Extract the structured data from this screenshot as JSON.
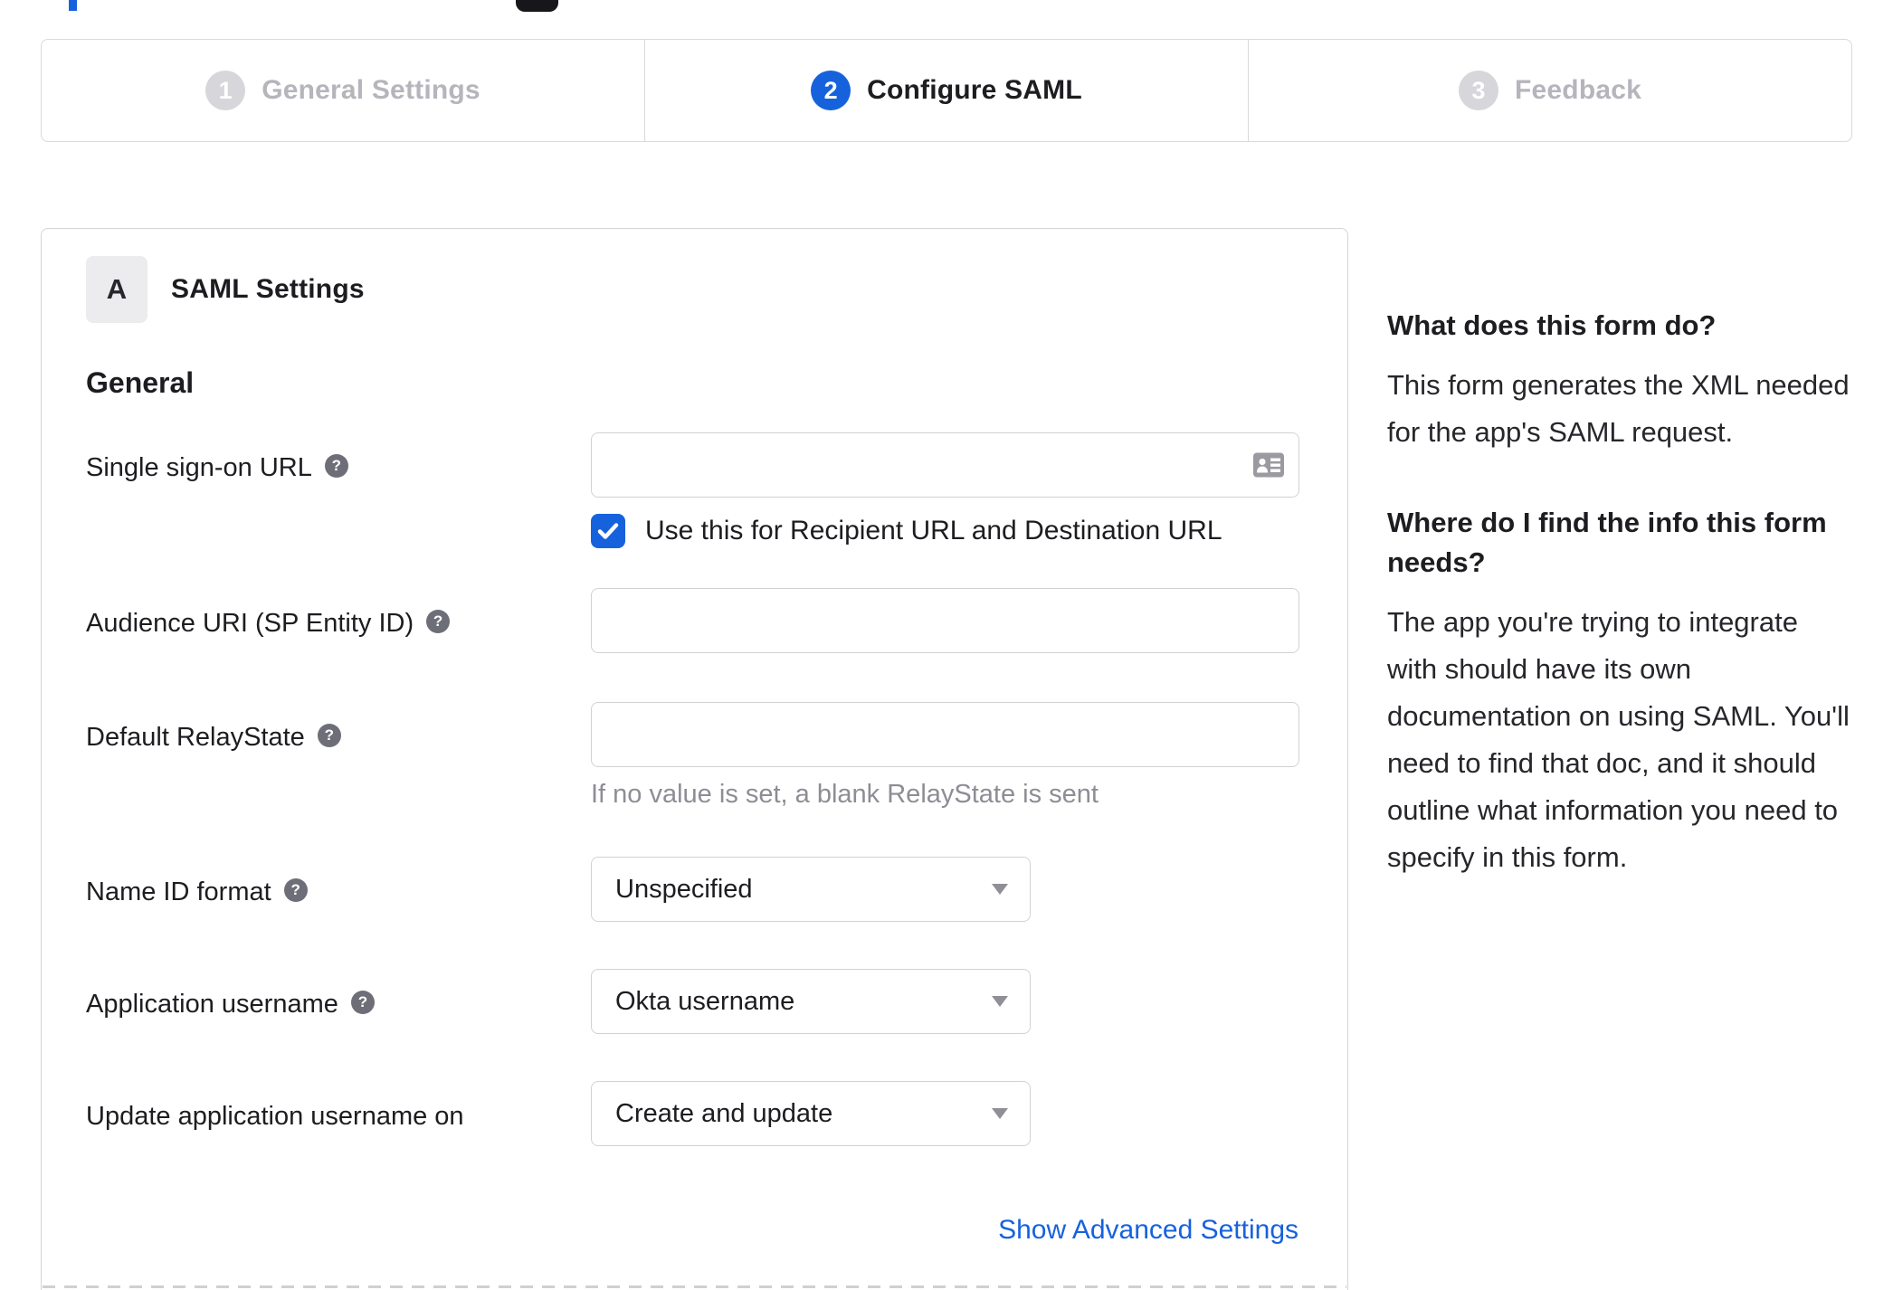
{
  "wizard": {
    "steps": [
      {
        "number": "1",
        "label": "General Settings",
        "state": "inactive"
      },
      {
        "number": "2",
        "label": "Configure SAML",
        "state": "active"
      },
      {
        "number": "3",
        "label": "Feedback",
        "state": "inactive"
      }
    ]
  },
  "panel": {
    "section_badge": "A",
    "section_title": "SAML Settings",
    "general_heading": "General",
    "fields": {
      "sso_url": {
        "label": "Single sign-on URL",
        "value": ""
      },
      "sso_checkbox": {
        "label": "Use this for Recipient URL and Destination URL",
        "checked": true
      },
      "audience_uri": {
        "label": "Audience URI (SP Entity ID)",
        "value": ""
      },
      "default_relay_state": {
        "label": "Default RelayState",
        "value": "",
        "hint": "If no value is set, a blank RelayState is sent"
      },
      "name_id_format": {
        "label": "Name ID format",
        "value": "Unspecified"
      },
      "application_username": {
        "label": "Application username",
        "value": "Okta username"
      },
      "update_application_username_on": {
        "label": "Update application username on",
        "value": "Create and update"
      }
    },
    "advanced_link_label": "Show Advanced Settings"
  },
  "help_sidebar": {
    "sections": [
      {
        "heading": "What does this form do?",
        "body": "This form generates the XML needed for the app's SAML request."
      },
      {
        "heading": "Where do I find the info this form needs?",
        "body": "The app you're trying to integrate with should have its own documentation on using SAML. You'll need to find that doc, and it should outline what information you need to specify in this form."
      }
    ]
  },
  "icons": {
    "help_glyph": "?"
  },
  "colors": {
    "accent": "#1662dd",
    "inactive_step": "#d6d6db",
    "border": "#d4d4d8"
  }
}
